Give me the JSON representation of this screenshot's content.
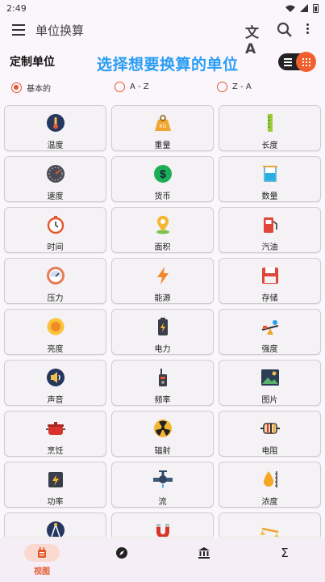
{
  "status_bar": {
    "time": "2:49"
  },
  "app_bar": {
    "title": "单位换算",
    "translate_glyph": "文A"
  },
  "section": {
    "title": "定制单位",
    "banner": "选择想要换算的单位"
  },
  "sort": {
    "options": [
      {
        "label": "基本的",
        "checked": true
      },
      {
        "label": "A - Z",
        "checked": false
      },
      {
        "label": "Z - A",
        "checked": false
      }
    ]
  },
  "units": [
    {
      "label": "温度",
      "icon": "thermometer-icon"
    },
    {
      "label": "重量",
      "icon": "weight-icon"
    },
    {
      "label": "长度",
      "icon": "ruler-icon"
    },
    {
      "label": "速度",
      "icon": "speedometer-icon"
    },
    {
      "label": "货币",
      "icon": "dollar-icon"
    },
    {
      "label": "数量",
      "icon": "beaker-icon"
    },
    {
      "label": "时间",
      "icon": "stopwatch-icon"
    },
    {
      "label": "面积",
      "icon": "location-pin-icon"
    },
    {
      "label": "汽油",
      "icon": "fuel-pump-icon"
    },
    {
      "label": "压力",
      "icon": "pressure-gauge-icon"
    },
    {
      "label": "能源",
      "icon": "lightning-icon"
    },
    {
      "label": "存储",
      "icon": "floppy-disk-icon"
    },
    {
      "label": "亮度",
      "icon": "sun-icon"
    },
    {
      "label": "电力",
      "icon": "battery-icon"
    },
    {
      "label": "强度",
      "icon": "seesaw-icon"
    },
    {
      "label": "声音",
      "icon": "speaker-icon"
    },
    {
      "label": "频率",
      "icon": "walkie-talkie-icon"
    },
    {
      "label": "图片",
      "icon": "picture-icon"
    },
    {
      "label": "烹饪",
      "icon": "cooking-pot-icon"
    },
    {
      "label": "辐射",
      "icon": "radiation-icon"
    },
    {
      "label": "电阻",
      "icon": "resistor-icon"
    },
    {
      "label": "功率",
      "icon": "power-meter-icon"
    },
    {
      "label": "流",
      "icon": "pipe-valve-icon"
    },
    {
      "label": "浓度",
      "icon": "drop-scale-icon"
    }
  ],
  "partial_units": [
    {
      "icon": "compass-drawing-icon"
    },
    {
      "icon": "magnet-icon"
    },
    {
      "icon": "scale-icon"
    }
  ],
  "bottom_nav": {
    "items": [
      {
        "label": "视图",
        "icon": "view-icon",
        "active": true
      },
      {
        "label": "",
        "icon": "compass-icon",
        "active": false
      },
      {
        "label": "",
        "icon": "bank-icon",
        "active": false
      },
      {
        "label": "",
        "icon": "sigma-icon",
        "active": false
      }
    ]
  },
  "colors": {
    "accent": "#e4572e",
    "banner": "#2a9df4",
    "card_bg": "#f4f2f4"
  }
}
